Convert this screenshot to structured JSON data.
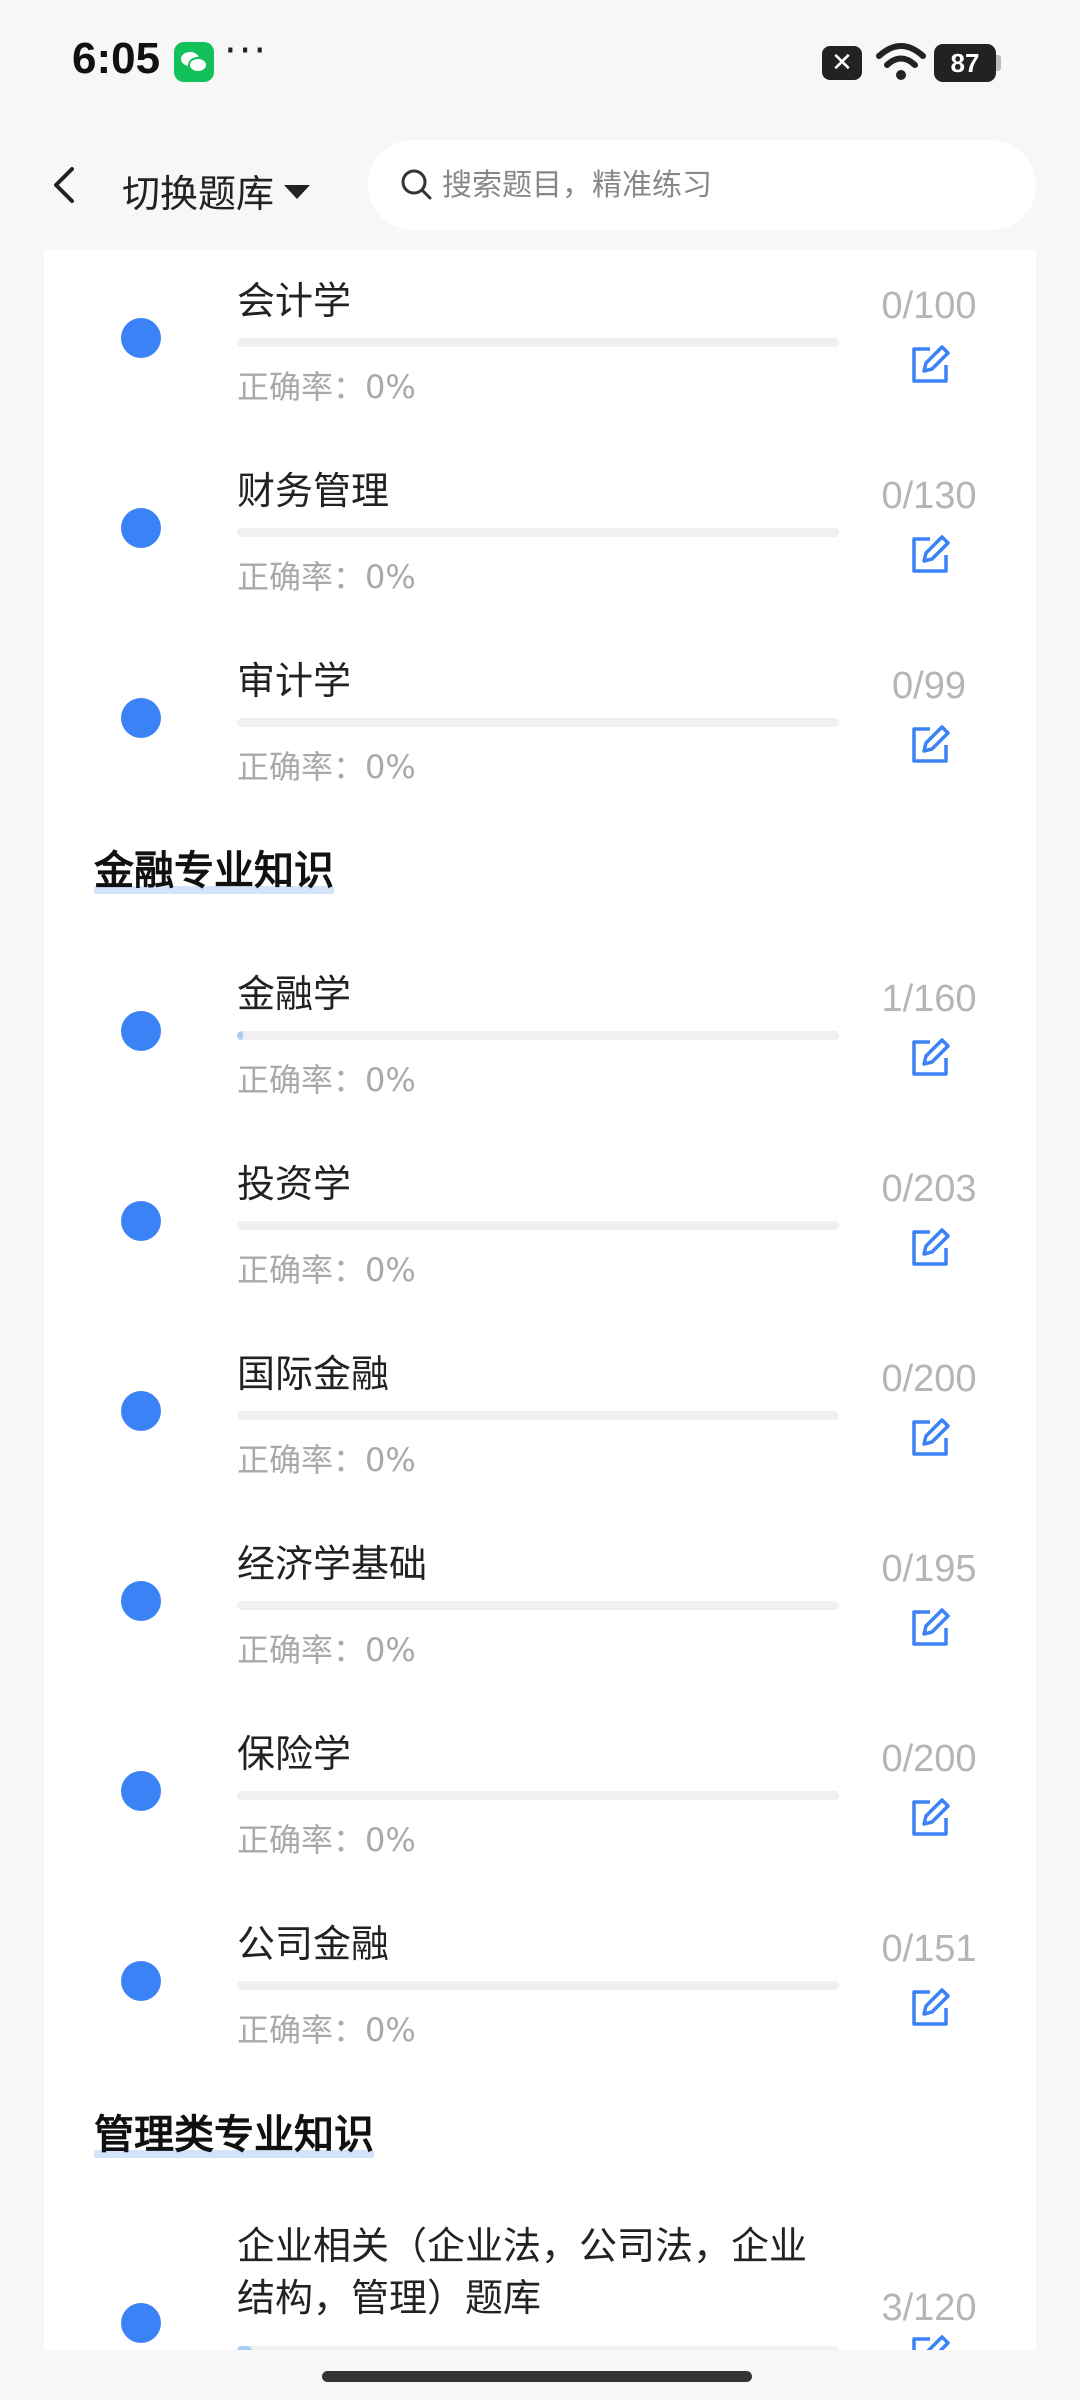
{
  "status_bar": {
    "time": "6:05",
    "dots": "···",
    "battery": "87"
  },
  "header": {
    "bank_switch_label": "切换题库",
    "search_placeholder": "搜索题目，精准练习"
  },
  "sections": [
    {
      "title": "",
      "items": [
        {
          "title": "会计学",
          "count": "0/100",
          "accuracy_label": "正确率：",
          "accuracy": "0%",
          "progress": 0
        },
        {
          "title": "财务管理",
          "count": "0/130",
          "accuracy_label": "正确率：",
          "accuracy": "0%",
          "progress": 0
        },
        {
          "title": "审计学",
          "count": "0/99",
          "accuracy_label": "正确率：",
          "accuracy": "0%",
          "progress": 0
        }
      ]
    },
    {
      "title": "金融专业知识",
      "items": [
        {
          "title": "金融学",
          "count": "1/160",
          "accuracy_label": "正确率：",
          "accuracy": "0%",
          "progress": 0.00625
        },
        {
          "title": "投资学",
          "count": "0/203",
          "accuracy_label": "正确率：",
          "accuracy": "0%",
          "progress": 0
        },
        {
          "title": "国际金融",
          "count": "0/200",
          "accuracy_label": "正确率：",
          "accuracy": "0%",
          "progress": 0
        },
        {
          "title": "经济学基础",
          "count": "0/195",
          "accuracy_label": "正确率：",
          "accuracy": "0%",
          "progress": 0
        },
        {
          "title": "保险学",
          "count": "0/200",
          "accuracy_label": "正确率：",
          "accuracy": "0%",
          "progress": 0
        },
        {
          "title": "公司金融",
          "count": "0/151",
          "accuracy_label": "正确率：",
          "accuracy": "0%",
          "progress": 0
        }
      ]
    },
    {
      "title": "管理类专业知识",
      "items": [
        {
          "title": "企业相关（企业法，公司法，企业结构，管理）题库",
          "count": "3/120",
          "accuracy_label": "",
          "accuracy": "",
          "progress": 0.025
        }
      ]
    }
  ],
  "colors": {
    "accent": "#3b82f6",
    "progress_fill": "#a8cdf0",
    "section_underline": "#d3e4fa"
  }
}
